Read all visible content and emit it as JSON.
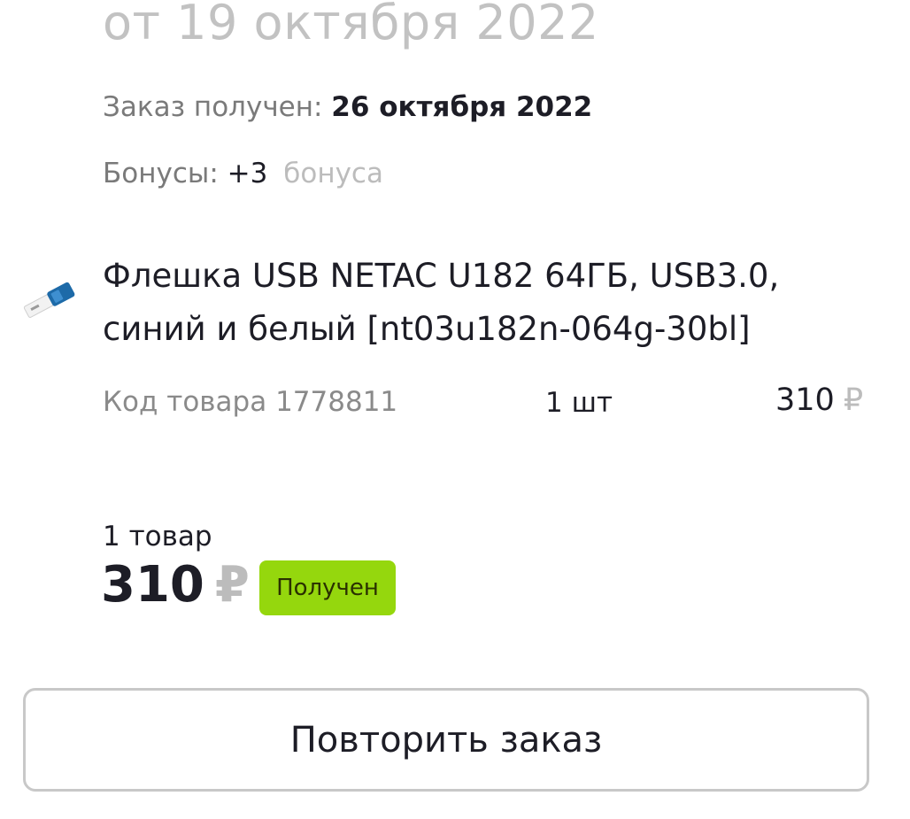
{
  "order": {
    "date_text": "от 19 октября 2022",
    "received_label": "Заказ получен:",
    "received_date": "26 октября 2022",
    "bonus_label": "Бонусы:",
    "bonus_value": "+3",
    "bonus_unit": "бонуса"
  },
  "item": {
    "image_icon": "usb-flash-drive",
    "name": "Флешка USB NETAC U182 64ГБ, USB3.0, синий и белый [nt03u182n-064g-30bl]",
    "sku_text": "Код товара 1778811",
    "quantity_text": "1 шт",
    "price": "310",
    "currency": "₽"
  },
  "summary": {
    "items_count_text": "1 товар",
    "total": "310",
    "currency": "₽",
    "status": "Получен",
    "status_color": "#95d70d"
  },
  "actions": {
    "repeat_label": "Повторить заказ"
  }
}
